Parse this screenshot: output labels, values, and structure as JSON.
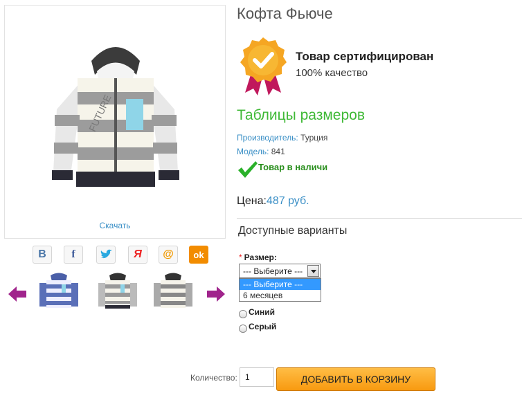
{
  "product": {
    "title": "Кофта Фьюче",
    "download_link": "Скачать"
  },
  "certification": {
    "title": "Товар сертифицирован",
    "subtitle": "100% качество"
  },
  "size_table_link": "Таблицы размеров",
  "meta": {
    "manufacturer_key": "Производитель:",
    "manufacturer_value": "Турция",
    "model_key": "Модель:",
    "model_value": "841"
  },
  "stock": {
    "text": "Товар в наличи"
  },
  "price": {
    "label": "Цена:",
    "value": "487 руб."
  },
  "variants": {
    "heading": "Доступные варианты",
    "size_required_mark": "*",
    "size_label": "Размер:",
    "select_value": "--- Выберите ---",
    "options": [
      "--- Выберите ---",
      "6 месяцев"
    ],
    "colors": [
      "Синий",
      "Серый"
    ]
  },
  "purchase": {
    "qty_label": "Количество:",
    "qty_value": "1",
    "cart_button": "ДОБАВИТЬ В КОРЗИНУ"
  },
  "share": {
    "buttons": [
      {
        "icon": "vk-icon",
        "glyph": "B",
        "color": "#4a76a8"
      },
      {
        "icon": "facebook-icon",
        "glyph": "f",
        "color": "#3b5998"
      },
      {
        "icon": "twitter-icon",
        "glyph": "t",
        "color": "#2aa9e0"
      },
      {
        "icon": "yandex-icon",
        "glyph": "Я",
        "color": "#e22"
      },
      {
        "icon": "mailru-icon",
        "glyph": "@",
        "color": "#f29a00"
      },
      {
        "icon": "odnoklassniki-icon",
        "glyph": "ok",
        "color": "#f28c00"
      }
    ]
  },
  "colors": {
    "link": "#3a8fc6",
    "green": "#3fb936",
    "cart_button": "#f89a10",
    "arrow": "#a0248c"
  }
}
